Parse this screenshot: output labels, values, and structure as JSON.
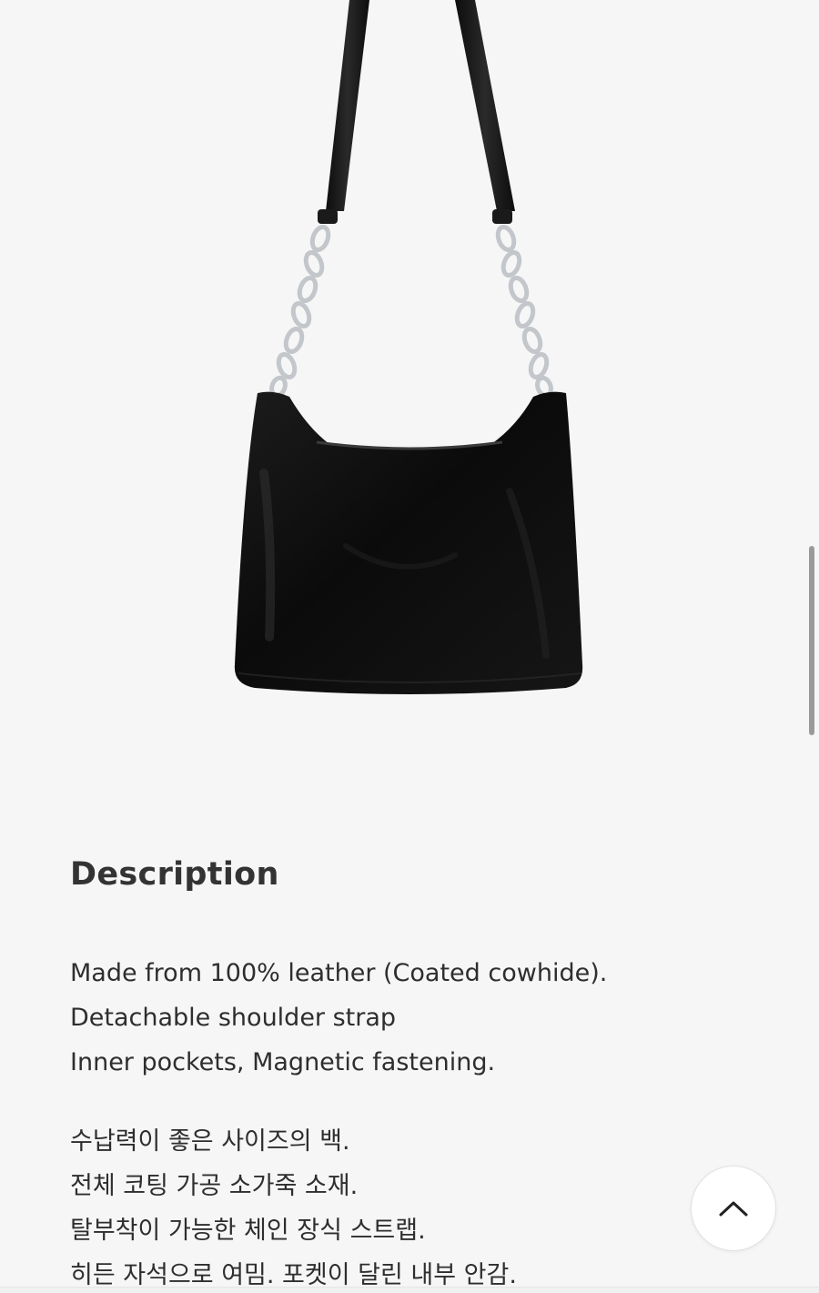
{
  "product": {
    "image_alt": "Black leather shoulder bag with silver chain strap"
  },
  "description": {
    "title": "Description",
    "english_lines": [
      "Made from 100% leather (Coated cowhide).",
      "Detachable shoulder strap",
      "Inner pockets, Magnetic fastening."
    ],
    "korean_lines": [
      "수납력이 좋은 사이즈의 백.",
      "전체 코팅 가공 소가죽 소재.",
      "탈부착이 가능한 체인 장식 스트랩.",
      "히든 자석으로 여밈. 포켓이 달린 내부 안감."
    ]
  },
  "controls": {
    "scroll_top_icon": "chevron-up-icon"
  },
  "colors": {
    "background": "#f6f6f6",
    "bag": "#111111",
    "chain": "#c9ccd0",
    "text": "#2e2e2e"
  }
}
